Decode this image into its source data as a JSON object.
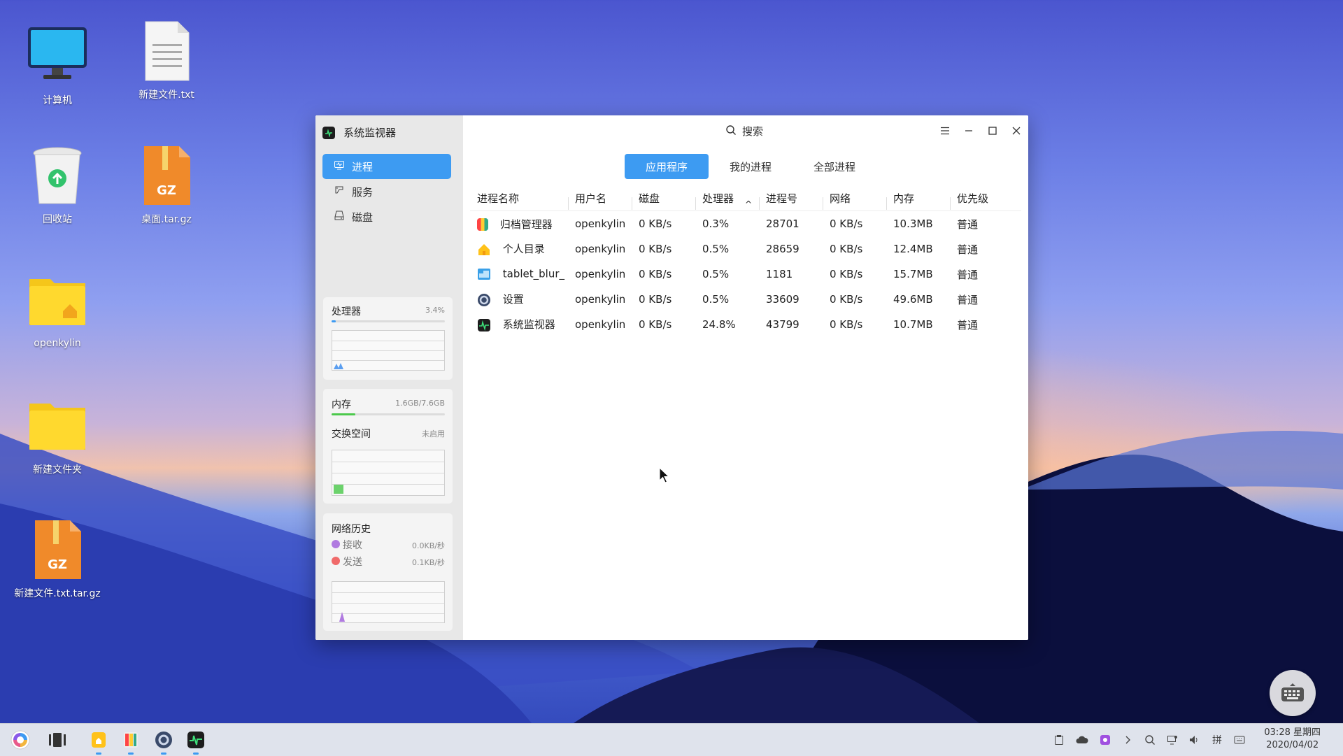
{
  "desktop": {
    "icons": [
      {
        "label": "计算机",
        "icon": "computer-icon"
      },
      {
        "label": "新建文件.txt",
        "icon": "text-file-icon"
      },
      {
        "label": "回收站",
        "icon": "trash-icon"
      },
      {
        "label": "桌面.tar.gz",
        "icon": "archive-icon"
      },
      {
        "label": "openkylin",
        "icon": "home-folder-icon"
      },
      {
        "label": "新建文件夹",
        "icon": "folder-icon"
      },
      {
        "label": "新建文件.txt.tar.gz",
        "icon": "archive-icon"
      }
    ],
    "archive_badge": "GZ"
  },
  "window": {
    "app_title": "系统监视器",
    "search_placeholder": "搜索",
    "sidebar": {
      "nav": [
        {
          "label": "进程",
          "active": true
        },
        {
          "label": "服务",
          "active": false
        },
        {
          "label": "磁盘",
          "active": false
        }
      ],
      "cpu": {
        "title": "处理器",
        "value": "3.4%",
        "percent": 3.4
      },
      "memory": {
        "title": "内存",
        "value": "1.6GB/7.6GB",
        "percent": 21
      },
      "swap": {
        "title": "交换空间",
        "value": "未启用"
      },
      "network": {
        "title": "网络历史",
        "recv_label": "接收",
        "recv_value": "0.0KB/秒",
        "send_label": "发送",
        "send_value": "0.1KB/秒"
      }
    },
    "tabs": [
      {
        "label": "应用程序",
        "active": true
      },
      {
        "label": "我的进程",
        "active": false
      },
      {
        "label": "全部进程",
        "active": false
      }
    ],
    "table": {
      "columns": [
        "进程名称",
        "用户名",
        "磁盘",
        "处理器",
        "进程号",
        "网络",
        "内存",
        "优先级"
      ],
      "sort_indicator": "^",
      "rows": [
        {
          "name": "归档管理器",
          "user": "openkylin",
          "disk": "0 KB/s",
          "cpu": "0.3%",
          "pid": "28701",
          "net": "0 KB/s",
          "mem": "10.3MB",
          "priority": "普通",
          "icon": "archive-manager-icon"
        },
        {
          "name": "个人目录",
          "user": "openkylin",
          "disk": "0 KB/s",
          "cpu": "0.5%",
          "pid": "28659",
          "net": "0 KB/s",
          "mem": "12.4MB",
          "priority": "普通",
          "icon": "home-icon"
        },
        {
          "name": "tablet_blur_",
          "user": "openkylin",
          "disk": "0 KB/s",
          "cpu": "0.5%",
          "pid": "1181",
          "net": "0 KB/s",
          "mem": "15.7MB",
          "priority": "普通",
          "icon": "tablet-blur-icon"
        },
        {
          "name": "设置",
          "user": "openkylin",
          "disk": "0 KB/s",
          "cpu": "0.5%",
          "pid": "33609",
          "net": "0 KB/s",
          "mem": "49.6MB",
          "priority": "普通",
          "icon": "settings-icon"
        },
        {
          "name": "系统监视器",
          "user": "openkylin",
          "disk": "0 KB/s",
          "cpu": "24.8%",
          "pid": "43799",
          "net": "0 KB/s",
          "mem": "10.7MB",
          "priority": "普通",
          "icon": "system-monitor-icon"
        }
      ]
    }
  },
  "taskbar": {
    "clock_time": "03:28 星期四",
    "clock_date": "2020/04/02",
    "ime_label": "拼"
  },
  "colors": {
    "accent": "#3d9bf2",
    "memory_bar": "#4cc94c"
  }
}
